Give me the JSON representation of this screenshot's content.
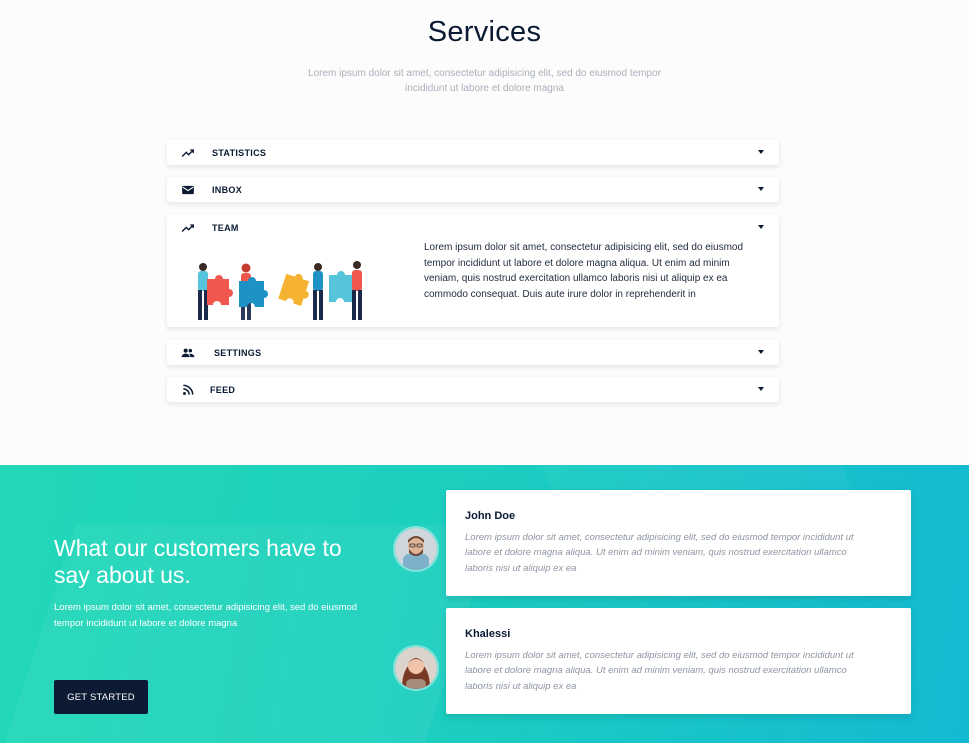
{
  "services": {
    "title": "Services",
    "subtitle": "Lorem ipsum dolor sit amet, consectetur adipisicing elit, sed do eiusmod tempor incididunt ut labore et dolore magna"
  },
  "accordion": {
    "items": [
      {
        "label": "STATISTICS",
        "icon": "trending-up-icon"
      },
      {
        "label": "INBOX",
        "icon": "mail-icon"
      },
      {
        "label": "TEAM",
        "icon": "trending-up-icon",
        "expanded": true,
        "body": "Lorem ipsum dolor sit amet, consectetur adipisicing elit, sed do eiusmod tempor incididunt ut labore et dolore magna aliqua. Ut enim ad minim veniam, quis nostrud exercitation ullamco laboris nisi ut aliquip ex ea commodo consequat. Duis aute irure dolor in reprehenderit in"
      },
      {
        "label": "SETTINGS",
        "icon": "people-icon"
      },
      {
        "label": "FEED",
        "icon": "rss-icon"
      }
    ]
  },
  "testimonials": {
    "title": "What our customers have to say about us.",
    "text": "Lorem ipsum dolor sit amet, consectetur adipisicing elit, sed do eiusmod tempor incididunt ut labore et dolore magna",
    "cta_label": "GET STARTED",
    "reviews": [
      {
        "name": "John Doe",
        "quote": "Lorem ipsum dolor sit amet, consectetur adipisicing elit, sed do eiusmod tempor incididunt ut labore et dolore magna aliqua. Ut enim ad minim veniam, quis nostrud exercitation ullamco laboris nisi ut aliquip ex ea"
      },
      {
        "name": "Khalessi",
        "quote": "Lorem ipsum dolor sit amet, consectetur adipisicing elit, sed do eiusmod tempor incididunt ut labore et dolore magna aliqua. Ut enim ad minim veniam, quis nostrud exercitation ullamco laboris nisi ut aliquip ex ea"
      }
    ]
  },
  "colors": {
    "navy": "#0b1a33",
    "teal_start": "#22d8b7",
    "teal_end": "#13b9d2",
    "puzzle_red": "#f0584f",
    "puzzle_blue": "#1e92c4",
    "puzzle_yellow": "#f6b231",
    "puzzle_light_blue": "#56c4da"
  }
}
